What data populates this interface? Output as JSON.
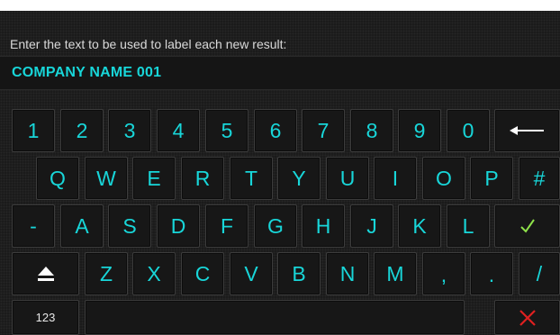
{
  "prompt": "Enter the text to be used to label each new result:",
  "field": {
    "value": "COMPANY NAME 001"
  },
  "keyboard": {
    "row1": [
      "1",
      "2",
      "3",
      "4",
      "5",
      "6",
      "7",
      "8",
      "9",
      "0"
    ],
    "row2": [
      "Q",
      "W",
      "E",
      "R",
      "T",
      "Y",
      "U",
      "I",
      "O",
      "P",
      "#"
    ],
    "row3": [
      "-",
      "A",
      "S",
      "D",
      "F",
      "G",
      "H",
      "J",
      "K",
      "L"
    ],
    "row4": [
      "Z",
      "X",
      "C",
      "V",
      "B",
      "N",
      "M",
      ",",
      ".",
      "/"
    ],
    "mode_key": "123",
    "icons": {
      "backspace": "left-arrow-icon",
      "enter": "checkmark-icon",
      "shift": "shift-up-arrow-icon",
      "cancel": "close-x-icon"
    }
  },
  "colors": {
    "key_text": "#18d6d9",
    "confirm": "#8fe24a",
    "cancel": "#e02020",
    "background": "#1b1b1b"
  }
}
